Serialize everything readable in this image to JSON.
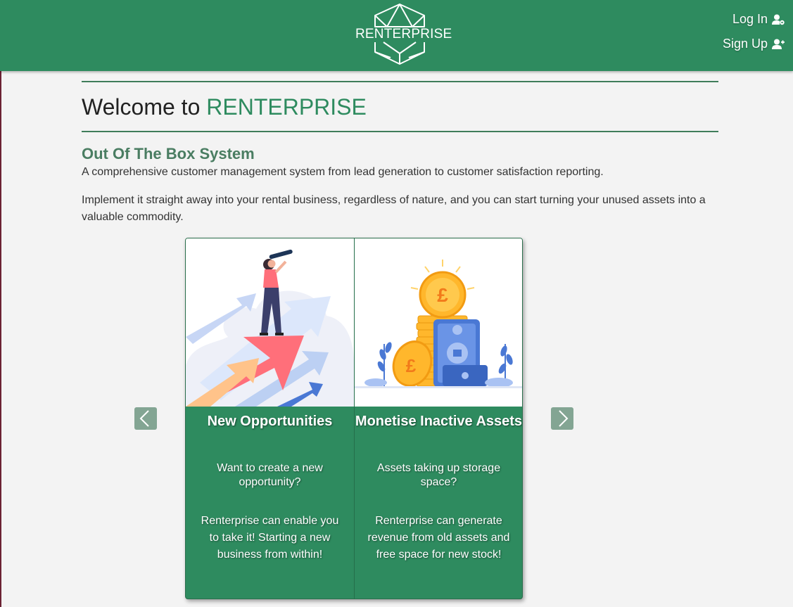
{
  "header": {
    "logo_text": "RENTERPRISE",
    "login_label": "Log In",
    "signup_label": "Sign Up",
    "brand_color": "#2e8b5f"
  },
  "main": {
    "welcome_prefix": "Welcome to ",
    "welcome_brand": "RENTERPRISE",
    "section_title": "Out Of The Box System",
    "paragraph1": "A comprehensive customer management system from lead generation to customer satisfaction reporting.",
    "paragraph2": "Implement it straight away into your rental business, regardless of nature, and you can start turning your unused assets into a valuable commodity."
  },
  "carousel": {
    "prev_icon": "chevron-left-icon",
    "next_icon": "chevron-right-icon",
    "slides": [
      {
        "title": "New Opportunities",
        "question": "Want to create a new opportunity?",
        "description": "Renterprise can enable you to take it! Starting a new business from within!",
        "illustration": "telescope-growth-illustration"
      },
      {
        "title": "Monetise Inactive Assets",
        "question": "Assets taking up storage space?",
        "description": "Renterprise can generate revenue from old assets and free space for new stock!",
        "illustration": "pound-coins-illustration"
      }
    ]
  }
}
